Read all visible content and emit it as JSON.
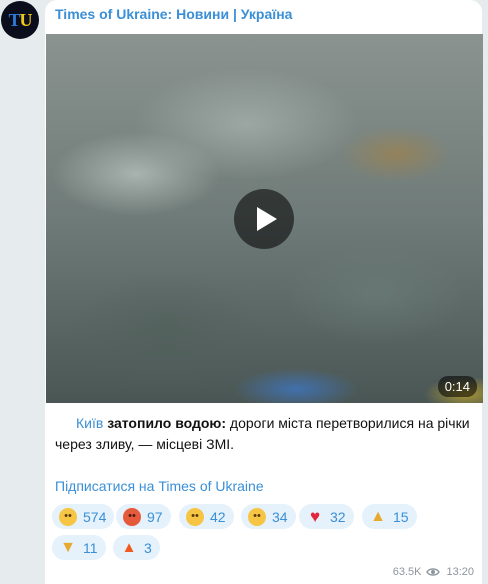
{
  "avatar": {
    "letter_t": "T",
    "letter_u": "U"
  },
  "channel": {
    "name": "Times of Ukraine: Новини | Україна"
  },
  "video": {
    "duration": "0:14"
  },
  "caption": {
    "city": "Київ",
    "bold": "затопило водою:",
    "rest": " дороги міста перетворилися на річки через зливу, — місцеві ЗМІ."
  },
  "subscribe_label": "Підписатися на Times of Ukraine",
  "reactions": [
    {
      "emoji": "crying-face",
      "count": "574"
    },
    {
      "emoji": "angry-face",
      "count": "97"
    },
    {
      "emoji": "thinking-face",
      "count": "42"
    },
    {
      "emoji": "grimacing-face",
      "count": "34"
    },
    {
      "emoji": "red-heart",
      "count": "32"
    },
    {
      "emoji": "thumbs-up",
      "count": "15"
    },
    {
      "emoji": "thumbs-down",
      "count": "11"
    },
    {
      "emoji": "fire",
      "count": "3"
    }
  ],
  "meta": {
    "views": "63.5K",
    "time": "13:20"
  }
}
